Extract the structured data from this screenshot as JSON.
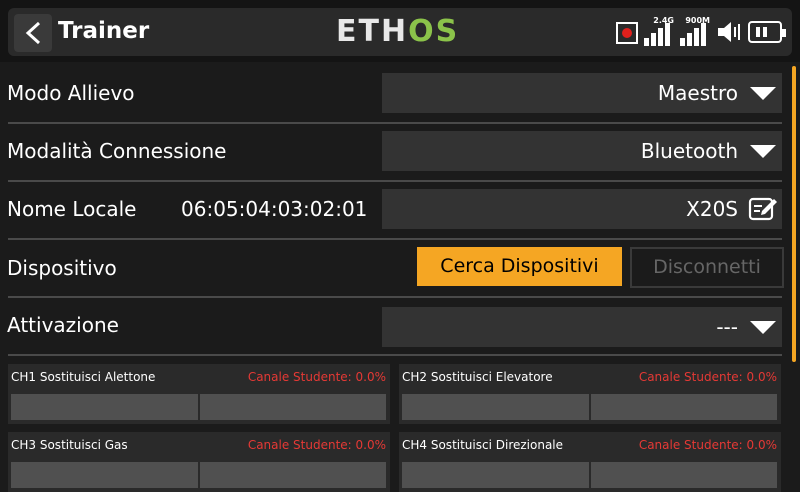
{
  "header": {
    "title": "Trainer",
    "logo_part1": "ETH",
    "logo_part2": "OS",
    "signal1_label": "2.4G",
    "signal2_label": "900M"
  },
  "rows": {
    "mode": {
      "label": "Modo Allievo",
      "value": "Maestro"
    },
    "connection": {
      "label": "Modalità Connessione",
      "value": "Bluetooth"
    },
    "local_name": {
      "label": "Nome Locale",
      "address": "06:05:04:03:02:01",
      "value": "X20S"
    },
    "device": {
      "label": "Dispositivo",
      "search_button": "Cerca Dispositivi",
      "disconnect_button": "Disconnetti"
    },
    "activation": {
      "label": "Attivazione",
      "value": "---"
    }
  },
  "channels": [
    {
      "name": "CH1 Sostituisci Alettone",
      "status": "Canale Studente: 0.0%"
    },
    {
      "name": "CH2 Sostituisci Elevatore",
      "status": "Canale Studente: 0.0%"
    },
    {
      "name": "CH3 Sostituisci Gas",
      "status": "Canale Studente: 0.0%"
    },
    {
      "name": "CH4 Sostituisci Direzionale",
      "status": "Canale Studente: 0.0%"
    }
  ],
  "colors": {
    "accent": "#f5a623",
    "record": "#e0201c",
    "channel_status": "#e53935",
    "logo_green": "#8bc34a"
  }
}
